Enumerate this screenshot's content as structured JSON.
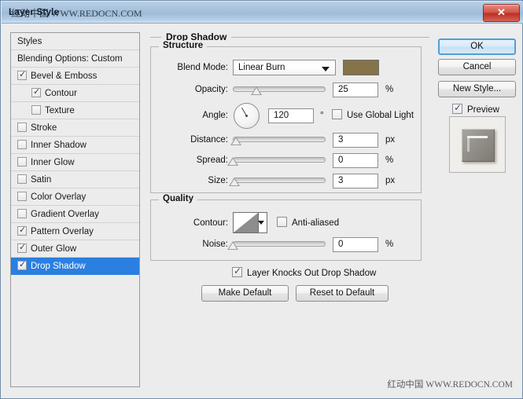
{
  "window": {
    "title": "Layer Style",
    "title_watermark": "红动中国 WWW.REDOCN.COM",
    "close_icon": "✕",
    "bottom_watermark": "红动中国 WWW.REDOCN.COM"
  },
  "styles_panel": {
    "header": "Styles",
    "blending_options": "Blending Options: Custom",
    "items": [
      {
        "label": "Bevel & Emboss",
        "checked": true,
        "indent": false,
        "selected": false
      },
      {
        "label": "Contour",
        "checked": true,
        "indent": true,
        "selected": false
      },
      {
        "label": "Texture",
        "checked": false,
        "indent": true,
        "selected": false
      },
      {
        "label": "Stroke",
        "checked": false,
        "indent": false,
        "selected": false
      },
      {
        "label": "Inner Shadow",
        "checked": false,
        "indent": false,
        "selected": false
      },
      {
        "label": "Inner Glow",
        "checked": false,
        "indent": false,
        "selected": false
      },
      {
        "label": "Satin",
        "checked": false,
        "indent": false,
        "selected": false
      },
      {
        "label": "Color Overlay",
        "checked": false,
        "indent": false,
        "selected": false
      },
      {
        "label": "Gradient Overlay",
        "checked": false,
        "indent": false,
        "selected": false
      },
      {
        "label": "Pattern Overlay",
        "checked": true,
        "indent": false,
        "selected": false
      },
      {
        "label": "Outer Glow",
        "checked": true,
        "indent": false,
        "selected": false
      },
      {
        "label": "Drop Shadow",
        "checked": true,
        "indent": false,
        "selected": true
      }
    ],
    "selected_color": "#2a7fe0"
  },
  "main": {
    "section_title": "Drop Shadow",
    "structure": {
      "title": "Structure",
      "blend_mode_label": "Blend Mode:",
      "blend_mode_value": "Linear Burn",
      "shadow_color": "#85734a",
      "opacity_label": "Opacity:",
      "opacity_value": "25",
      "opacity_unit": "%",
      "opacity_percent": 25,
      "angle_label": "Angle:",
      "angle_value": "120",
      "angle_unit": "°",
      "use_global_light_label": "Use Global Light",
      "use_global_light_checked": false,
      "distance_label": "Distance:",
      "distance_value": "3",
      "distance_unit": "px",
      "distance_percent": 3,
      "spread_label": "Spread:",
      "spread_value": "0",
      "spread_unit": "%",
      "spread_percent": 0,
      "size_label": "Size:",
      "size_value": "3",
      "size_unit": "px",
      "size_percent": 2
    },
    "quality": {
      "title": "Quality",
      "contour_label": "Contour:",
      "anti_aliased_label": "Anti-aliased",
      "anti_aliased_checked": false,
      "noise_label": "Noise:",
      "noise_value": "0",
      "noise_unit": "%",
      "noise_percent": 0
    },
    "knockout_label": "Layer Knocks Out Drop Shadow",
    "knockout_checked": true,
    "make_default_label": "Make Default",
    "reset_default_label": "Reset to Default"
  },
  "right_panel": {
    "ok_label": "OK",
    "cancel_label": "Cancel",
    "new_style_label": "New Style...",
    "preview_label": "Preview",
    "preview_checked": true
  }
}
